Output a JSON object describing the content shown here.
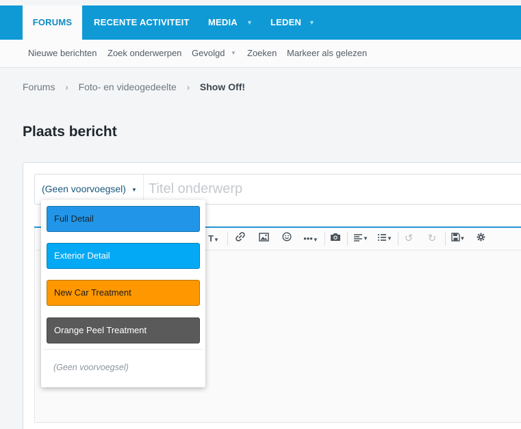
{
  "navbar": {
    "tabs": [
      {
        "label": "FORUMS",
        "active": true
      },
      {
        "label": "RECENTE ACTIVITEIT"
      },
      {
        "label": "MEDIA",
        "has_menu": true
      },
      {
        "label": "LEDEN",
        "has_menu": true
      }
    ]
  },
  "subnav": {
    "items": [
      {
        "label": "Nieuwe berichten"
      },
      {
        "label": "Zoek onderwerpen"
      },
      {
        "label": "Gevolgd",
        "has_menu": true
      },
      {
        "label": "Zoeken"
      },
      {
        "label": "Markeer als gelezen"
      }
    ]
  },
  "breadcrumb": [
    "Forums",
    "Foto- en videogedeelte",
    "Show Off!"
  ],
  "page_title": "Plaats bericht",
  "form": {
    "prefix_selected": "(Geen voorvoegsel)",
    "title_placeholder": "Titel onderwerp"
  },
  "toolbar": {
    "icons": [
      "text-size-icon",
      "link-icon",
      "image-icon",
      "smiley-icon",
      "more-icon",
      "camera-icon",
      "align-icon",
      "list-icon",
      "undo-icon",
      "redo-icon",
      "save-draft-icon",
      "settings-icon"
    ]
  },
  "prefix_dropdown": {
    "options": [
      {
        "label": "Full Detail",
        "color": "#2196e8",
        "text_color": "#16232e"
      },
      {
        "label": "Exterior Detail",
        "color": "#03a9f4",
        "text_color": "#ffffff"
      },
      {
        "label": "New Car Treatment",
        "color": "#ff9800",
        "text_color": "#1a1a1a"
      },
      {
        "label": "Orange Peel Treatment",
        "color": "#5a5a5a",
        "text_color": "#ffffff"
      }
    ],
    "none_label": "(Geen voorvoegsel)"
  },
  "colors": {
    "navbar": "#0f9ad6",
    "accent": "#2196d6"
  }
}
